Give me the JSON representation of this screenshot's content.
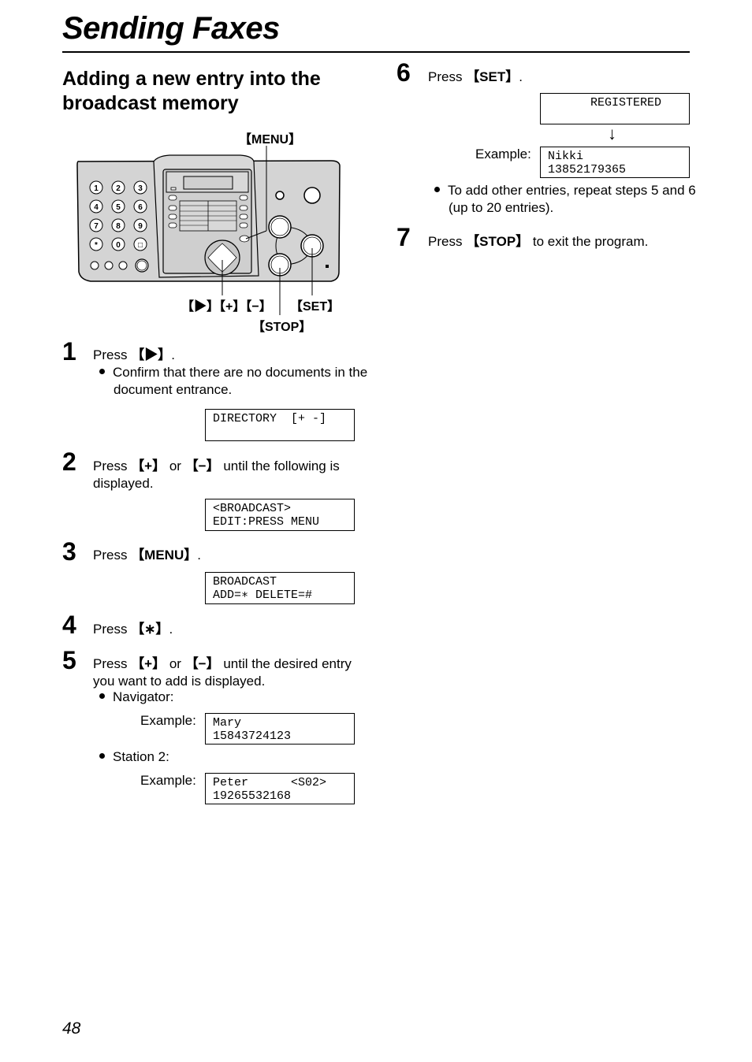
{
  "header": {
    "title": "Sending Faxes"
  },
  "section": {
    "title": "Adding a new entry into the broadcast memory"
  },
  "diagram": {
    "callouts": {
      "menu": "【MENU】",
      "nav": "【▶】【+】【−】",
      "set": "【SET】",
      "stop": "【STOP】"
    },
    "keypad": [
      "1",
      "2",
      "3",
      "4",
      "5",
      "6",
      "7",
      "8",
      "9",
      "*",
      "0",
      "□"
    ]
  },
  "steps": [
    {
      "num": "1",
      "pre": "Press ",
      "key": "【▶】",
      "post": ".",
      "bullet": "Confirm that there are no documents in the document entrance.",
      "lcd": [
        "DIRECTORY  [+ -]",
        ""
      ]
    },
    {
      "num": "2",
      "pre": "Press ",
      "key": "【+】",
      "mid": " or ",
      "key2": "【−】",
      "post": " until the following is displayed.",
      "lcd": [
        "<BROADCAST>",
        "EDIT:PRESS MENU"
      ]
    },
    {
      "num": "3",
      "pre": "Press ",
      "key": "【MENU】",
      "post": ".",
      "lcd": [
        "BROADCAST",
        "ADD=∗ DELETE=#"
      ]
    },
    {
      "num": "4",
      "pre": "Press ",
      "key": "【∗】",
      "post": "."
    },
    {
      "num": "5",
      "pre": "Press ",
      "key": "【+】",
      "mid": " or ",
      "key2": "【−】",
      "post": " until the desired entry you want to add is displayed.",
      "bullets": [
        {
          "text": "Navigator:",
          "example_label": "Example:",
          "lcd": [
            "Mary",
            "15843724123"
          ]
        },
        {
          "text": "Station 2:",
          "example_label": "Example:",
          "lcd": [
            "Peter      <S02>",
            "19265532168"
          ]
        }
      ]
    },
    {
      "num": "6",
      "pre": "Press ",
      "key": "【SET】",
      "post": ".",
      "lcd_first": [
        "      REGISTERED",
        ""
      ],
      "arrow": "↓",
      "example_label": "Example:",
      "lcd": [
        "Nikki",
        "13852179365"
      ],
      "bullet": "To add other entries, repeat steps 5 and 6 (up to 20 entries)."
    },
    {
      "num": "7",
      "pre": "Press ",
      "key": "【STOP】",
      "post": " to exit the program."
    }
  ],
  "footer": {
    "page_number": "48"
  }
}
